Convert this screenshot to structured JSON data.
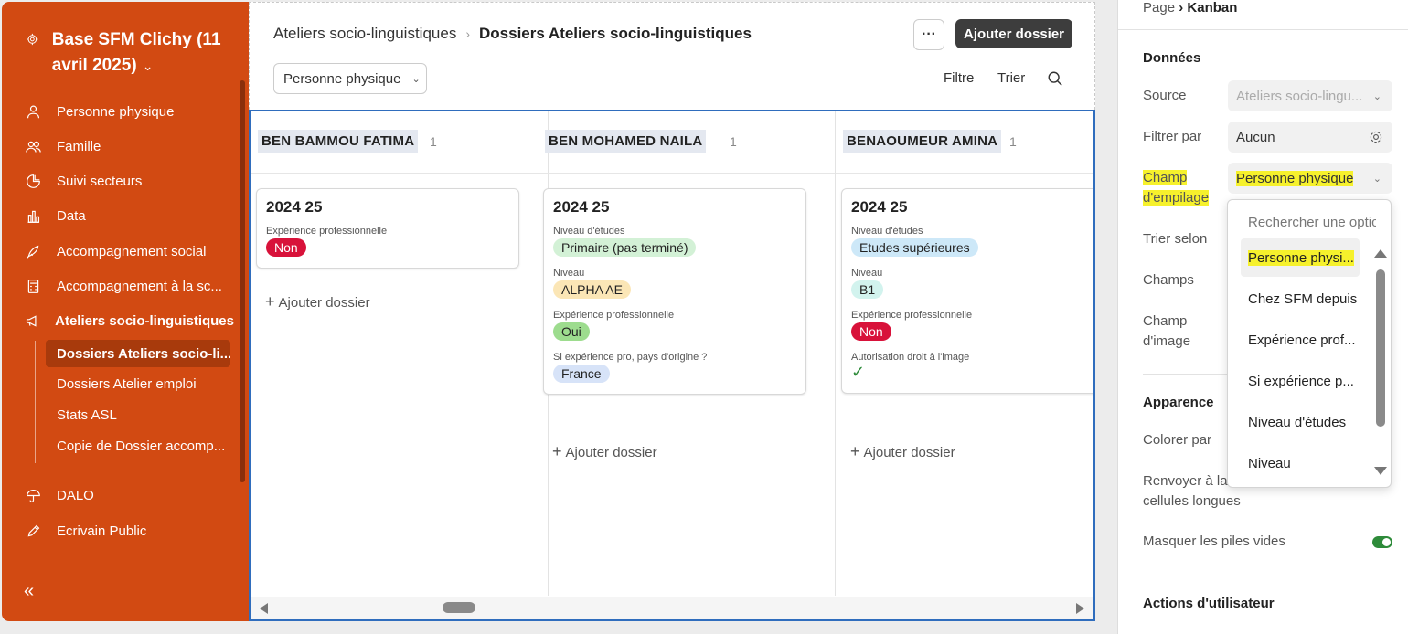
{
  "colors": {
    "sidebar_bg": "#d24a12",
    "sidebar_active": "#a83a0c",
    "board_border": "#2f6dbd",
    "highlight": "#f6f12c",
    "toggle_on": "#2e8b3a"
  },
  "sidebar": {
    "title": "Base SFM Clichy (11 avril 2025)",
    "title_chevron": "⌄",
    "items": [
      {
        "label": "Personne physique",
        "icon": "person-icon"
      },
      {
        "label": "Famille",
        "icon": "people-icon"
      },
      {
        "label": "Suivi secteurs",
        "icon": "pie-icon"
      },
      {
        "label": "Data",
        "icon": "bar-chart-icon"
      },
      {
        "label": "Accompagnement social",
        "icon": "rocket-icon"
      },
      {
        "label": "Accompagnement à la sc...",
        "icon": "calculator-icon"
      },
      {
        "label": "Ateliers socio-linguistiques",
        "icon": "megaphone-icon"
      },
      {
        "label": "DALO",
        "icon": "umbrella-icon"
      },
      {
        "label": "Ecrivain Public",
        "icon": "pencil-icon"
      }
    ],
    "subitems": [
      {
        "label": "Dossiers Ateliers socio-li...",
        "active": true
      },
      {
        "label": "Dossiers Atelier emploi",
        "active": false
      },
      {
        "label": "Stats ASL",
        "active": false
      },
      {
        "label": "Copie de Dossier accomp...",
        "active": false
      }
    ],
    "collapse_label": "«"
  },
  "header": {
    "breadcrumb_parent": "Ateliers socio-linguistiques",
    "breadcrumb_sep": "›",
    "breadcrumb_current": "Dossiers Ateliers socio-linguistiques",
    "more_label": "···",
    "add_label": "Ajouter dossier",
    "group_select": "Personne physique",
    "filter_label": "Filtre",
    "sort_label": "Trier"
  },
  "board": {
    "add_label": "Ajouter dossier",
    "columns": [
      {
        "title": "BEN BAMMOU FATIMA",
        "count": "1",
        "card": {
          "title": "2024 25",
          "fields": [
            {
              "label": "Expérience professionnelle",
              "value": "Non",
              "bg": "#d8123a",
              "fg": "#ffffff"
            }
          ]
        }
      },
      {
        "title": "BEN MOHAMED NAILA",
        "count": "1",
        "card": {
          "title": "2024 25",
          "fields": [
            {
              "label": "Niveau d'études",
              "value": "Primaire (pas terminé)",
              "bg": "#d3f1d6",
              "fg": "#222222"
            },
            {
              "label": "Niveau",
              "value": "ALPHA AE",
              "bg": "#fbe6b6",
              "fg": "#222222"
            },
            {
              "label": "Expérience professionnelle",
              "value": "Oui",
              "bg": "#9ddc8e",
              "fg": "#222222"
            },
            {
              "label": "Si expérience pro, pays d'origine ?",
              "value": "France",
              "bg": "#d7e3f8",
              "fg": "#222222"
            }
          ]
        }
      },
      {
        "title": "BENAOUMEUR AMINA",
        "count": "1",
        "card": {
          "title": "2024 25",
          "fields": [
            {
              "label": "Niveau d'études",
              "value": "Etudes supérieures",
              "bg": "#cde8f8",
              "fg": "#222222"
            },
            {
              "label": "Niveau",
              "value": "B1",
              "bg": "#d2f3ee",
              "fg": "#222222"
            },
            {
              "label": "Expérience professionnelle",
              "value": "Non",
              "bg": "#d8123a",
              "fg": "#ffffff"
            },
            {
              "label": "Autorisation droit à l'image",
              "value": "✓",
              "bg": "",
              "fg": "#2e8b3a"
            }
          ]
        }
      }
    ]
  },
  "panel": {
    "crumb_page": "Page",
    "crumb_sep": "›",
    "crumb_current": "Kanban",
    "section_data": "Données",
    "source_label": "Source",
    "source_value": "Ateliers socio-lingu...",
    "filter_label": "Filtrer par",
    "filter_value": "Aucun",
    "stack_label_1": "Champ",
    "stack_label_2": "d'empilage",
    "stack_value": "Personne physique",
    "sort_label": "Trier selon",
    "fields_label": "Champs",
    "image_label_1": "Champ",
    "image_label_2": "d'image",
    "section_appearance": "Apparence",
    "color_label": "Colorer par",
    "wrap_label_1": "Renvoyer à la lig",
    "wrap_label_2": "cellules longues",
    "hide_empty_label": "Masquer les piles vides",
    "hide_empty_on": true,
    "section_actions": "Actions d'utilisateur"
  },
  "dropdown": {
    "search_placeholder": "Rechercher une optic",
    "options": [
      "Personne physi...",
      "Chez SFM depuis",
      "Expérience prof...",
      "Si expérience p...",
      "Niveau d'études",
      "Niveau"
    ],
    "selected_index": 0
  }
}
